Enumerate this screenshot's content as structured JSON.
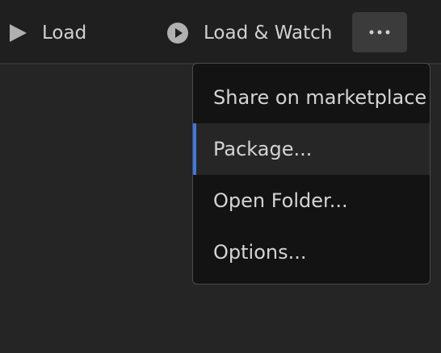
{
  "toolbar": {
    "load_label": "Load",
    "load_icon": "play-icon",
    "watch_label": "Load & Watch",
    "watch_icon": "play-circle-icon",
    "more_icon": "ellipsis-icon"
  },
  "menu": {
    "items": [
      {
        "label": "Share on marketplace",
        "active": false
      },
      {
        "label": "Package...",
        "active": true
      },
      {
        "label": "Open Folder...",
        "active": false
      },
      {
        "label": "Options...",
        "active": false
      }
    ]
  },
  "colors": {
    "accent": "#3f78e0",
    "background": "#252525",
    "toolbar": "#1f1f1f",
    "menu_background": "#131313",
    "text": "#d2d2d2"
  }
}
